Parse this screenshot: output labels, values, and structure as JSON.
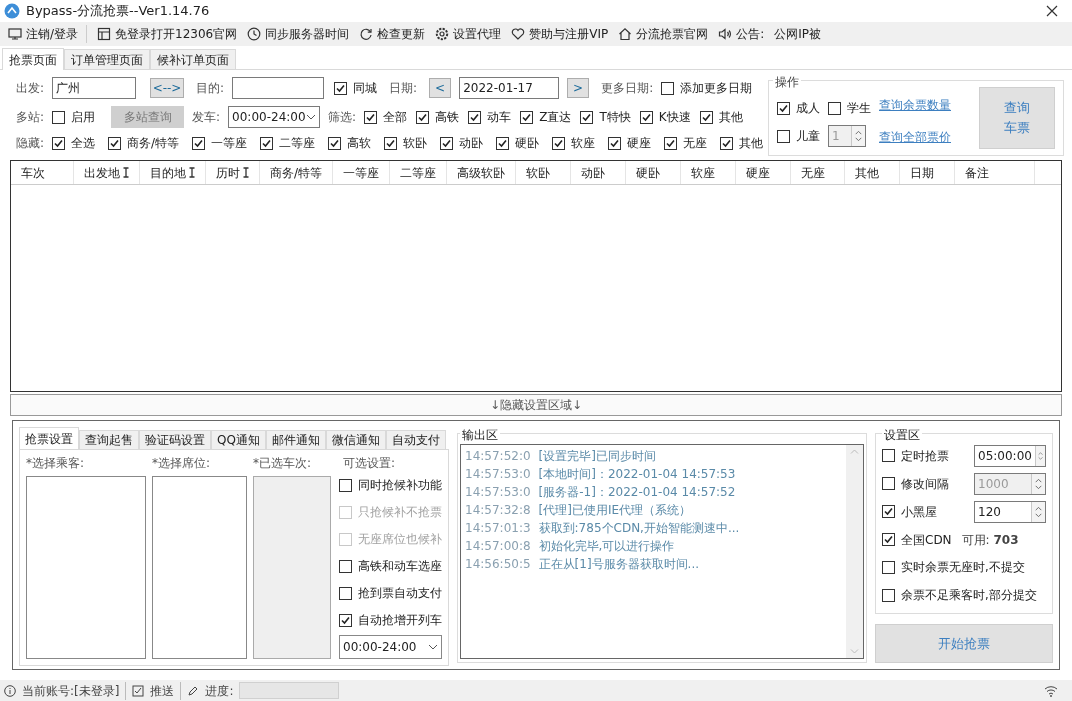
{
  "window": {
    "title": "Bypass-分流抢票--Ver1.14.76"
  },
  "toolbar": [
    {
      "kind": "monitor",
      "label": "注销/登录"
    },
    {
      "kind": "window",
      "label": "免登录打开12306官网"
    },
    {
      "kind": "clock",
      "label": "同步服务器时间"
    },
    {
      "kind": "refresh",
      "label": "检查更新"
    },
    {
      "kind": "gear",
      "label": "设置代理"
    },
    {
      "kind": "heart",
      "label": "赞助与注册VIP"
    },
    {
      "kind": "home",
      "label": "分流抢票官网"
    },
    {
      "kind": "speaker",
      "label": "公告:"
    }
  ],
  "announcement": "公网IP被",
  "tabs": [
    {
      "label": "抢票页面",
      "selected": true
    },
    {
      "label": "订单管理页面",
      "selected": false
    },
    {
      "label": "候补订单页面",
      "selected": false
    }
  ],
  "query": {
    "from_label": "出发:",
    "from_value": "广州",
    "swap": "<-->",
    "to_label": "目的:",
    "same_city": {
      "label": "同城",
      "checked": true
    },
    "date_label": "日期:",
    "prev": "<",
    "date": "2022-01-17",
    "next": ">",
    "more_dates_label": "更多日期:",
    "add_more": {
      "label": "添加更多日期",
      "checked": false
    },
    "multi_label": "多站:",
    "multi_enable": {
      "label": "启用",
      "checked": false
    },
    "multi_button": {
      "label": "多站查询",
      "disabled": true
    },
    "depart_label": "发车:",
    "depart_value": "00:00-24:00",
    "filter_label": "筛选:",
    "filters": [
      {
        "label": "全部",
        "checked": true
      },
      {
        "label": "高铁",
        "checked": true
      },
      {
        "label": "动车",
        "checked": true
      },
      {
        "label": "Z直达",
        "checked": true
      },
      {
        "label": "T特快",
        "checked": true
      },
      {
        "label": "K快速",
        "checked": true
      },
      {
        "label": "其他",
        "checked": true
      }
    ],
    "hide_label": "隐藏:",
    "hides": [
      {
        "label": "全选",
        "checked": true
      },
      {
        "label": "商务/特等",
        "checked": true
      },
      {
        "label": "一等座",
        "checked": true
      },
      {
        "label": "二等座",
        "checked": true
      },
      {
        "label": "高软",
        "checked": true
      },
      {
        "label": "软卧",
        "checked": true
      },
      {
        "label": "动卧",
        "checked": true
      },
      {
        "label": "硬卧",
        "checked": true
      },
      {
        "label": "软座",
        "checked": true
      },
      {
        "label": "硬座",
        "checked": true
      },
      {
        "label": "无座",
        "checked": true
      },
      {
        "label": "其他",
        "checked": true
      }
    ]
  },
  "operation": {
    "title": "操作",
    "adult": {
      "label": "成人",
      "checked": true
    },
    "student": {
      "label": "学生",
      "checked": false
    },
    "child": {
      "label": "儿童",
      "checked": false
    },
    "child_count": {
      "value": "1",
      "disabled": true
    },
    "links": [
      "查询余票数量",
      "查询全部票价"
    ],
    "query_button": [
      "查询",
      "车票"
    ]
  },
  "table": {
    "columns": [
      {
        "label": "车次",
        "sortable": false
      },
      {
        "label": "出发地",
        "sortable": true
      },
      {
        "label": "目的地",
        "sortable": true
      },
      {
        "label": "历时",
        "sortable": true
      },
      {
        "label": "商务/特等",
        "sortable": false
      },
      {
        "label": "一等座",
        "sortable": false
      },
      {
        "label": "二等座",
        "sortable": false
      },
      {
        "label": "高级软卧",
        "sortable": false
      },
      {
        "label": "软卧",
        "sortable": false
      },
      {
        "label": "动卧",
        "sortable": false
      },
      {
        "label": "硬卧",
        "sortable": false
      },
      {
        "label": "软座",
        "sortable": false
      },
      {
        "label": "硬座",
        "sortable": false
      },
      {
        "label": "无座",
        "sortable": false
      },
      {
        "label": "其他",
        "sortable": false
      },
      {
        "label": "日期",
        "sortable": false
      },
      {
        "label": "备注",
        "sortable": false
      }
    ]
  },
  "hide_settings_bar": "↓隐藏设置区域↓",
  "settings_tabs": [
    {
      "label": "抢票设置",
      "selected": true
    },
    {
      "label": "查询起售",
      "selected": false
    },
    {
      "label": "验证码设置",
      "selected": false
    },
    {
      "label": "QQ通知",
      "selected": false
    },
    {
      "label": "邮件通知",
      "selected": false
    },
    {
      "label": "微信通知",
      "selected": false
    },
    {
      "label": "自动支付",
      "selected": false
    }
  ],
  "ticket_settings": {
    "passenger_label": "*选择乘客:",
    "seat_label": "*选择席位:",
    "train_label": "*已选车次:",
    "options_label": "可选设置:",
    "options": [
      {
        "label": "同时抢候补功能",
        "checked": false,
        "disabled": false
      },
      {
        "label": "只抢候补不抢票",
        "checked": false,
        "disabled": true
      },
      {
        "label": "无座席位也候补",
        "checked": false,
        "disabled": true
      },
      {
        "label": "高铁和动车选座",
        "checked": false,
        "disabled": false
      },
      {
        "label": "抢到票自动支付",
        "checked": false,
        "disabled": false
      },
      {
        "label": "自动抢增开列车",
        "checked": true,
        "disabled": false
      }
    ],
    "time_value": "00:00-24:00"
  },
  "output": {
    "title": "输出区",
    "lines": [
      {
        "time": "14:57:52:0",
        "text": "[设置完毕]已同步时间"
      },
      {
        "time": "14:57:53:0",
        "text": "[本地时间]：2022-01-04 14:57:53"
      },
      {
        "time": "14:57:53:0",
        "text": "[服务器-1]：2022-01-04 14:57:52"
      },
      {
        "time": "14:57:32:8",
        "text": "[代理]已使用IE代理（系统）"
      },
      {
        "time": "14:57:01:3",
        "text": "获取到:785个CDN,开始智能测速中..."
      },
      {
        "time": "14:57:00:8",
        "text": "初始化完毕,可以进行操作"
      },
      {
        "time": "14:56:50:5",
        "text": "正在从[1]号服务器获取时间..."
      }
    ]
  },
  "settings_area": {
    "title": "设置区",
    "items": [
      {
        "kind": "spin",
        "label": "定时抢票",
        "checked": false,
        "value": "05:00:00",
        "disabled": false
      },
      {
        "kind": "spin",
        "label": "修改间隔",
        "checked": false,
        "value": "1000",
        "disabled": true
      },
      {
        "kind": "spin",
        "label": "小黑屋",
        "checked": true,
        "value": "120",
        "disabled": false
      },
      {
        "kind": "count",
        "label": "全国CDN",
        "checked": true,
        "count_label": "可用:",
        "count": "703"
      },
      {
        "kind": "plain",
        "label": "实时余票无座时,不提交",
        "checked": false
      },
      {
        "kind": "plain",
        "label": "余票不足乘客时,部分提交",
        "checked": false
      }
    ],
    "start_button": "开始抢票"
  },
  "status_bar": {
    "account": "当前账号:[未登录]",
    "push": "推送",
    "progress_label": "进度:"
  }
}
